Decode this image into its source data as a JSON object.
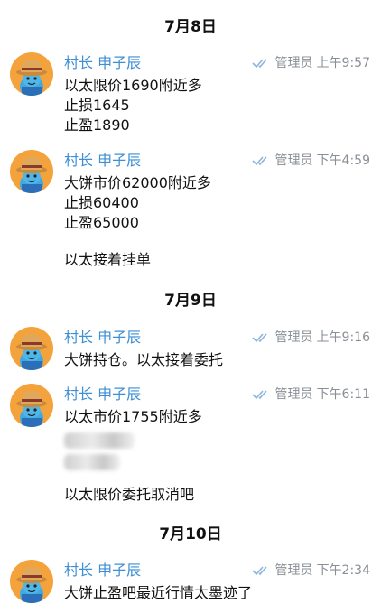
{
  "chat": {
    "day1": "7月8日",
    "day2": "7月9日",
    "day3": "7月10日",
    "sender_name": "村长 申子辰",
    "role_label": "管理员",
    "tick_icon": "double-check-icon",
    "messages": [
      {
        "time": "上午9:57",
        "lines": [
          "以太限价1690附近多",
          "止损1645",
          "止盈1890"
        ]
      },
      {
        "time": "下午4:59",
        "lines": [
          "大饼市价62000附近多",
          "止损60400",
          "止盈65000",
          "以太接着挂单"
        ]
      },
      {
        "time": "上午9:16",
        "lines": [
          "大饼持仓。以太接着委托"
        ]
      },
      {
        "time": "下午6:11",
        "lines": [
          "以太市价1755附近多",
          "以太限价委托取消吧"
        ]
      },
      {
        "time": "下午2:34",
        "lines": [
          "大饼止盈吧最近行情太墨迹了"
        ]
      }
    ]
  },
  "colors": {
    "sender": "#3d8fd6",
    "meta": "#8a8f96",
    "avatar_bg": "#f4a23c"
  }
}
